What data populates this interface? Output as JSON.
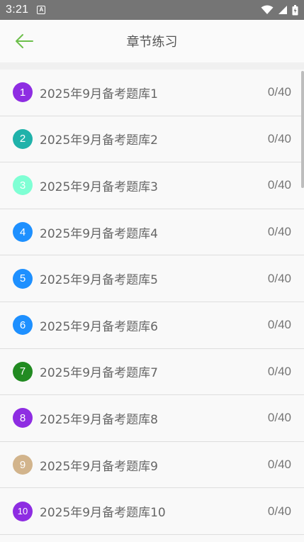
{
  "statusbar": {
    "time": "3:21",
    "notification_icon_letter": "A",
    "icons": [
      "wifi-icon",
      "signal-icon",
      "battery-icon"
    ]
  },
  "appbar": {
    "title": "章节练习",
    "back_icon": "arrow-left-icon",
    "accent": "#6dbf4b"
  },
  "chapters": [
    {
      "num": "1",
      "title": "2025年9月备考题库1",
      "progress": "0/40",
      "color": "#8e2de2"
    },
    {
      "num": "2",
      "title": "2025年9月备考题库2",
      "progress": "0/40",
      "color": "#20b2aa"
    },
    {
      "num": "3",
      "title": "2025年9月备考题库3",
      "progress": "0/40",
      "color": "#7fffd4"
    },
    {
      "num": "4",
      "title": "2025年9月备考题库4",
      "progress": "0/40",
      "color": "#1e90ff"
    },
    {
      "num": "5",
      "title": "2025年9月备考题库5",
      "progress": "0/40",
      "color": "#1e90ff"
    },
    {
      "num": "6",
      "title": "2025年9月备考题库6",
      "progress": "0/40",
      "color": "#1e90ff"
    },
    {
      "num": "7",
      "title": "2025年9月备考题库7",
      "progress": "0/40",
      "color": "#228b22"
    },
    {
      "num": "8",
      "title": "2025年9月备考题库8",
      "progress": "0/40",
      "color": "#8e2de2"
    },
    {
      "num": "9",
      "title": "2025年9月备考题库9",
      "progress": "0/40",
      "color": "#d2b48c"
    },
    {
      "num": "10",
      "title": "2025年9月备考题库10",
      "progress": "0/40",
      "color": "#8e2de2"
    }
  ]
}
